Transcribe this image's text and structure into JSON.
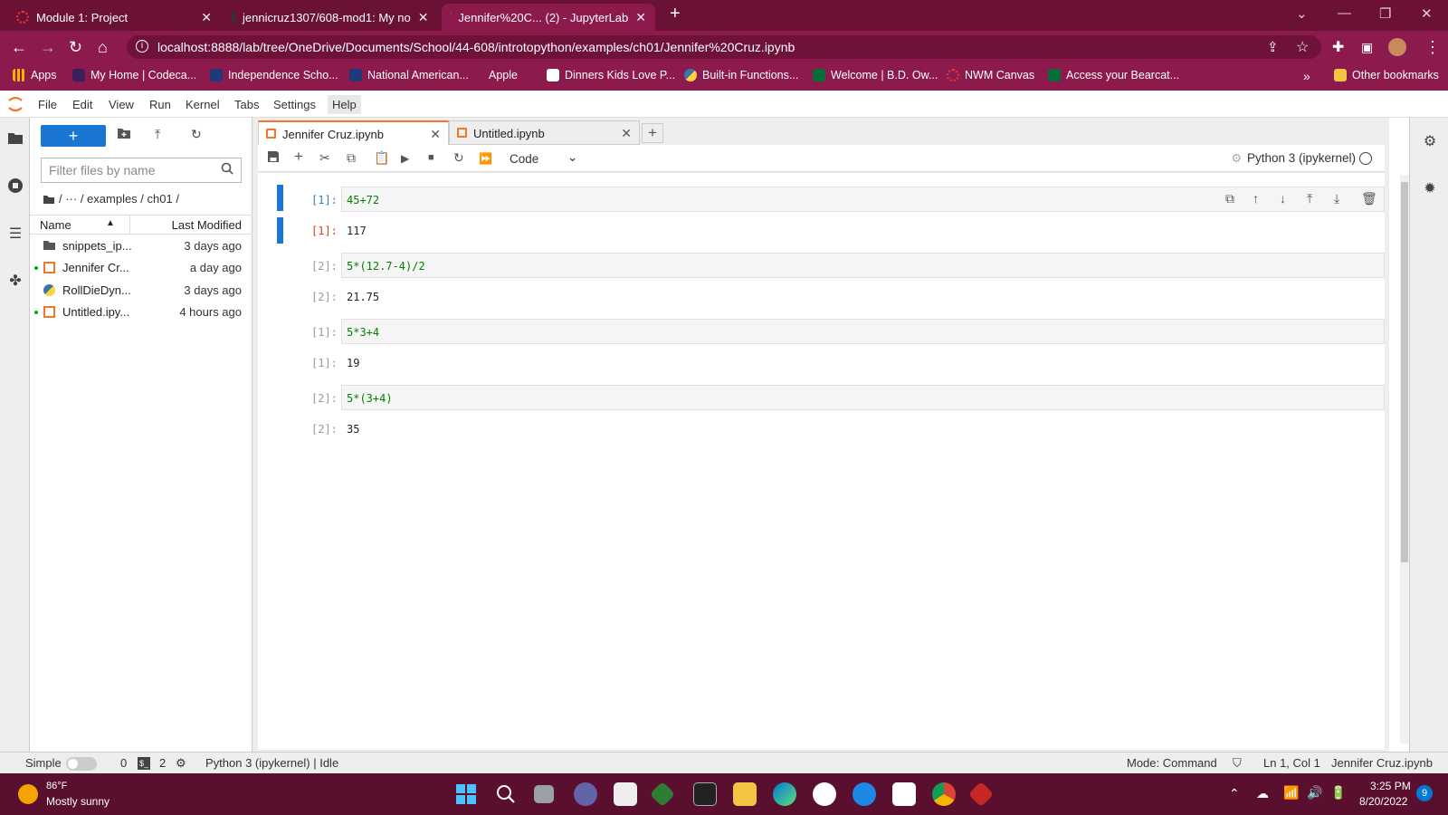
{
  "browser": {
    "tabs": [
      {
        "title": "Module 1: Project"
      },
      {
        "title": "jennicruz1307/608-mod1: My no"
      },
      {
        "title": "Jennifer%20C... (2) - JupyterLab"
      }
    ],
    "url": "localhost:8888/lab/tree/OneDrive/Documents/School/44-608/introtopython/examples/ch01/Jennifer%20Cruz.ipynb",
    "bookmarks": [
      "Apps",
      "My Home | Codeca...",
      "Independence Scho...",
      "National American...",
      "Apple",
      "Dinners Kids Love P...",
      "Built-in Functions...",
      "Welcome | B.D. Ow...",
      "NWM Canvas",
      "Access your Bearcat..."
    ],
    "more_bookmarks": "»",
    "other_bookmarks": "Other bookmarks"
  },
  "menubar": {
    "items": [
      "File",
      "Edit",
      "View",
      "Run",
      "Kernel",
      "Tabs",
      "Settings",
      "Help"
    ]
  },
  "filebrowser": {
    "new_label": "+",
    "filter_placeholder": "Filter files by name",
    "breadcrumb": "/ ··· / examples / ch01 /",
    "col_name": "Name",
    "col_modified": "Last Modified",
    "files": [
      {
        "name": "snippets_ip...",
        "modified": "3 days ago",
        "type": "folder",
        "running": false
      },
      {
        "name": "Jennifer Cr...",
        "modified": "a day ago",
        "type": "notebook",
        "running": true
      },
      {
        "name": "RollDieDyn...",
        "modified": "3 days ago",
        "type": "python",
        "running": false
      },
      {
        "name": "Untitled.ipy...",
        "modified": "4 hours ago",
        "type": "notebook",
        "running": true
      }
    ]
  },
  "doctabs": [
    {
      "title": "Jennifer Cruz.ipynb",
      "active": true
    },
    {
      "title": "Untitled.ipynb",
      "active": false
    }
  ],
  "toolbar": {
    "cell_type": "Code",
    "kernel": "Python 3 (ipykernel)"
  },
  "cells": [
    {
      "in_prompt": "[1]:",
      "code": "45+72",
      "out_prompt": "[1]:",
      "output": "117",
      "active": true
    },
    {
      "in_prompt": "[2]:",
      "code": "5*(12.7-4)/2",
      "out_prompt": "[2]:",
      "output": "21.75",
      "active": false
    },
    {
      "in_prompt": "[1]:",
      "code": "5*3+4",
      "out_prompt": "[1]:",
      "output": "19",
      "active": false
    },
    {
      "in_prompt": "[2]:",
      "code": "5*(3+4)",
      "out_prompt": "[2]:",
      "output": "35",
      "active": false
    }
  ],
  "statusbar": {
    "mode_label": "Simple",
    "terminals": "0",
    "kernels": "2",
    "kernel_status": "Python 3 (ipykernel) | Idle",
    "mode": "Mode: Command",
    "position": "Ln 1, Col 1",
    "filename": "Jennifer Cruz.ipynb"
  },
  "taskbar": {
    "weather_temp": "86°F",
    "weather_desc": "Mostly sunny",
    "time": "3:25 PM",
    "date": "8/20/2022",
    "notif_count": "9"
  },
  "colors": {
    "browser_dark": "#6b1136",
    "browser_mid": "#8c1a4c",
    "jupyter_blue": "#1976d2",
    "jupyter_orange": "#f37726"
  }
}
